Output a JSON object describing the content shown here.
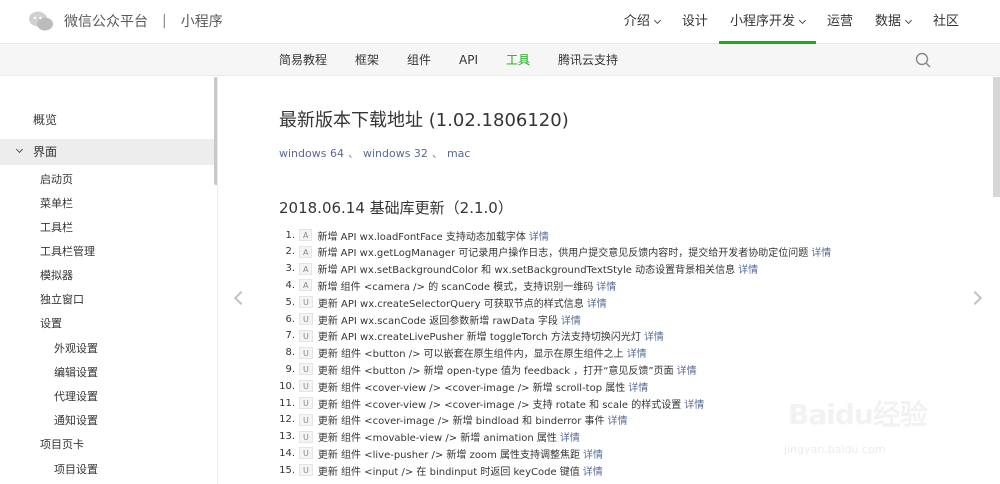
{
  "header": {
    "brand": "微信公众平台",
    "separator": "|",
    "product": "小程序",
    "nav": [
      {
        "label": "介绍",
        "has_dropdown": true,
        "active": false
      },
      {
        "label": "设计",
        "has_dropdown": false,
        "active": false
      },
      {
        "label": "小程序开发",
        "has_dropdown": true,
        "active": true
      },
      {
        "label": "运营",
        "has_dropdown": false,
        "active": false
      },
      {
        "label": "数据",
        "has_dropdown": true,
        "active": false
      },
      {
        "label": "社区",
        "has_dropdown": false,
        "active": false
      }
    ],
    "accent_color": "#1aad19"
  },
  "subnav": {
    "items": [
      {
        "label": "简易教程",
        "active": false
      },
      {
        "label": "框架",
        "active": false
      },
      {
        "label": "组件",
        "active": false
      },
      {
        "label": "API",
        "active": false
      },
      {
        "label": "工具",
        "active": true
      },
      {
        "label": "腾讯云支持",
        "active": false
      }
    ],
    "search_icon": "search-icon"
  },
  "sidebar": {
    "items": [
      {
        "label": "概览",
        "level": 0,
        "open": false
      },
      {
        "label": "界面",
        "level": 0,
        "open": true
      },
      {
        "label": "启动页",
        "level": 1
      },
      {
        "label": "菜单栏",
        "level": 1
      },
      {
        "label": "工具栏",
        "level": 1
      },
      {
        "label": "工具栏管理",
        "level": 1
      },
      {
        "label": "模拟器",
        "level": 1
      },
      {
        "label": "独立窗口",
        "level": 1
      },
      {
        "label": "设置",
        "level": 1
      },
      {
        "label": "外观设置",
        "level": 2
      },
      {
        "label": "编辑设置",
        "level": 2
      },
      {
        "label": "代理设置",
        "level": 2
      },
      {
        "label": "通知设置",
        "level": 2
      },
      {
        "label": "项目页卡",
        "level": 1
      },
      {
        "label": "项目设置",
        "level": 2
      }
    ]
  },
  "content": {
    "title": "最新版本下载地址 (1.02.1806120)",
    "downloads": [
      "windows 64",
      "windows 32",
      "mac"
    ],
    "download_separator": "、",
    "update_title": "2018.06.14 基础库更新（2.1.0）",
    "more_label": "详情",
    "changes": [
      {
        "num": "1.",
        "tag": "A",
        "text": "新增 API  wx.loadFontFace  支持动态加载字体"
      },
      {
        "num": "2.",
        "tag": "A",
        "text": "新增 API  wx.getLogManager  可记录用户操作日志，供用户提交意见反馈内容时，提交给开发者协助定位问题"
      },
      {
        "num": "3.",
        "tag": "A",
        "text": "新增 API  wx.setBackgroundColor  和  wx.setBackgroundTextStyle  动态设置背景相关信息"
      },
      {
        "num": "4.",
        "tag": "A",
        "text": "新增 组件  <camera />  的  scanCode  模式，支持识别一维码"
      },
      {
        "num": "5.",
        "tag": "U",
        "text": "更新 API  wx.createSelectorQuery  可获取节点的样式信息"
      },
      {
        "num": "6.",
        "tag": "U",
        "text": "更新 API  wx.scanCode  返回参数新增  rawData  字段"
      },
      {
        "num": "7.",
        "tag": "U",
        "text": "更新 API  wx.createLivePusher  新增  toggleTorch  方法支持切换闪光灯"
      },
      {
        "num": "8.",
        "tag": "U",
        "text": "更新 组件  <button />  可以嵌套在原生组件内，显示在原生组件之上"
      },
      {
        "num": "9.",
        "tag": "U",
        "text": "更新 组件  <button />  新增  open-type  值为  feedback ，打开“意见反馈”页面"
      },
      {
        "num": "10.",
        "tag": "U",
        "text": "更新 组件  <cover-view />   <cover-image />  新增  scroll-top  属性"
      },
      {
        "num": "11.",
        "tag": "U",
        "text": "更新 组件  <cover-view />   <cover-image />  支持 rotate 和 scale 的样式设置"
      },
      {
        "num": "12.",
        "tag": "U",
        "text": "更新 组件  <cover-image />  新增  bindload  和  binderror  事件"
      },
      {
        "num": "13.",
        "tag": "U",
        "text": "更新 组件  <movable-view />  新增  animation  属性"
      },
      {
        "num": "14.",
        "tag": "U",
        "text": "更新 组件  <live-pusher />  新增  zoom  属性支持调整焦距"
      },
      {
        "num": "15.",
        "tag": "U",
        "text": "更新 组件  <input />  在  bindinput  时返回  keyCode  键值"
      }
    ]
  },
  "watermark": {
    "text": "Baidu经验",
    "url": "jingyan.baidu.com"
  }
}
